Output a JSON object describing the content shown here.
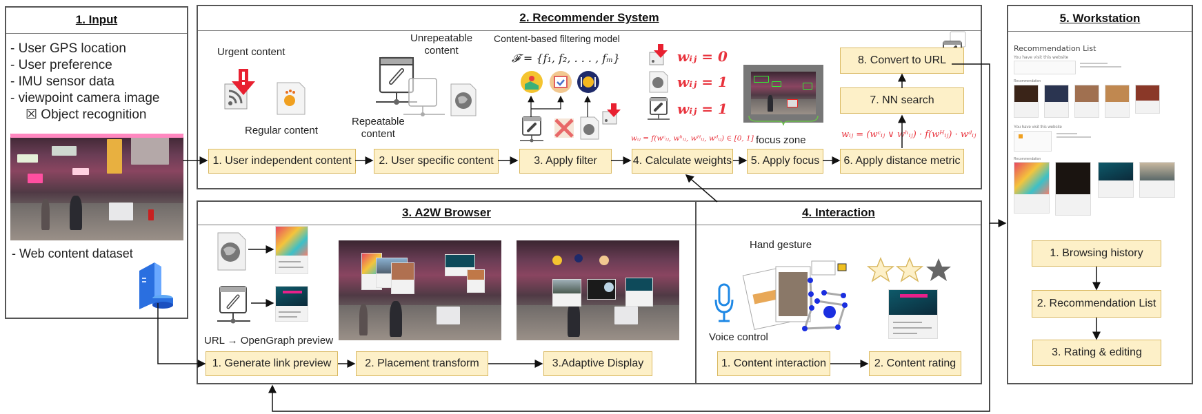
{
  "panels": {
    "input": {
      "title": "1. Input",
      "items": [
        "- User GPS location",
        "- User preference",
        "- IMU sensor data",
        "- viewpoint camera image",
        "☒ Object recognition"
      ],
      "dataset_label": "- Web content dataset"
    },
    "recommender": {
      "title": "2. Recommender System",
      "labels": {
        "urgent": "Urgent content",
        "regular": "Regular content",
        "unrepeatable": [
          "Unrepeatable",
          "content"
        ],
        "repeatable": [
          "Repeatable",
          "content"
        ],
        "cbf_model": "Content-based filtering model",
        "cbf_formula": "𝓕 = {f₁, f₂, . . . , fₘ}",
        "focus_zone": "focus zone"
      },
      "weights": [
        "wᵢⱼ = 0",
        "wᵢⱼ = 1",
        "wᵢⱼ = 1"
      ],
      "weight_formula": "wᵢⱼ = f(wᶜᵢⱼ, wʰᵢⱼ, wᴴᵢⱼ, wᵈᵢⱼ) ∈ [0, 1]",
      "distance_formula": "wᵢⱼ = (wᶜᵢⱼ ∨ wʰᵢⱼ) · f(wᴴᵢⱼ) · wᵈᵢⱼ",
      "steps": [
        "1. User independent content",
        "2. User specific content",
        "3. Apply filter",
        "4. Calculate weights",
        "5. Apply focus",
        "6. Apply distance metric",
        "7. NN search",
        "8. Convert to URL"
      ]
    },
    "browser": {
      "title": "3. A2W Browser",
      "caption": "URL → OpenGraph preview",
      "steps": [
        "1. Generate link preview",
        "2. Placement transform",
        "3.Adaptive Display"
      ]
    },
    "interaction": {
      "title": "4. Interaction",
      "hand_label": "Hand gesture",
      "voice_label": "Voice control",
      "rating": {
        "filled": 2,
        "total": 3
      },
      "steps": [
        "1. Content interaction",
        "2. Content rating"
      ]
    },
    "workstation": {
      "title": "5. Workstation",
      "screenshot": {
        "heading": "Recommendation List",
        "visited_label": "You have visit this website",
        "recommendation_label": "Recommendation"
      },
      "steps": [
        "1. Browsing history",
        "2. Recommendation List",
        "3. Rating & editing"
      ]
    }
  },
  "colors": {
    "step_fill": "#fdf0c8",
    "step_border": "#d9b860",
    "formula_red": "#e8323c",
    "panel_border": "#555555",
    "mic_blue": "#1e88e5",
    "hand_blue": "#1a2ee0"
  }
}
